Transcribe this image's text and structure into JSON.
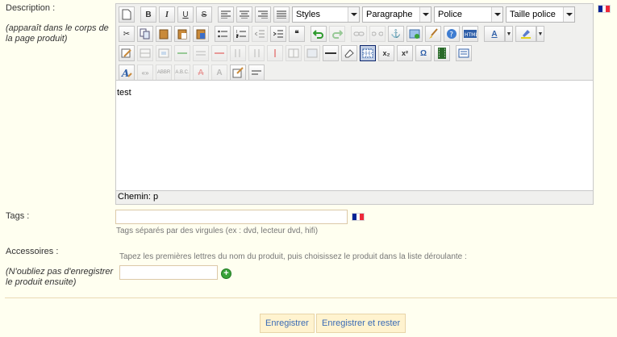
{
  "description": {
    "label": "Description :",
    "note": "(apparaît dans le corps de la page produit)",
    "editor": {
      "content": "test",
      "path": "Chemin: p",
      "dropdowns": {
        "styles": "Styles",
        "format": "Paragraphe",
        "font": "Police",
        "size": "Taille police"
      },
      "glyphs": {
        "bold": "B",
        "italic": "I",
        "underline": "U",
        "strike": "S",
        "blockquote": "❝",
        "subscript": "x₂",
        "superscript": "x²",
        "omega": "Ω",
        "text_color": "A",
        "char_format": "A"
      }
    }
  },
  "tags": {
    "label": "Tags :",
    "value": "",
    "hint": "Tags séparés par des virgules (ex : dvd, lecteur dvd, hifi)"
  },
  "accessories": {
    "label": "Accessoires :",
    "hint": "Tapez les premières lettres du nom du produit, puis choisissez le produit dans la liste déroulante :",
    "note": "(N'oubliez pas d'enregistrer le produit ensuite)",
    "value": ""
  },
  "buttons": {
    "save": "Enregistrer",
    "save_stay": "Enregistrer et rester"
  },
  "colors": {
    "background": "#fffff0",
    "button_bg": "#fff3cf",
    "button_text": "#3a6bb5",
    "flag_blue": "#002395",
    "flag_white": "#ffffff",
    "flag_red": "#ed2939",
    "add_green": "#3aa33a"
  }
}
